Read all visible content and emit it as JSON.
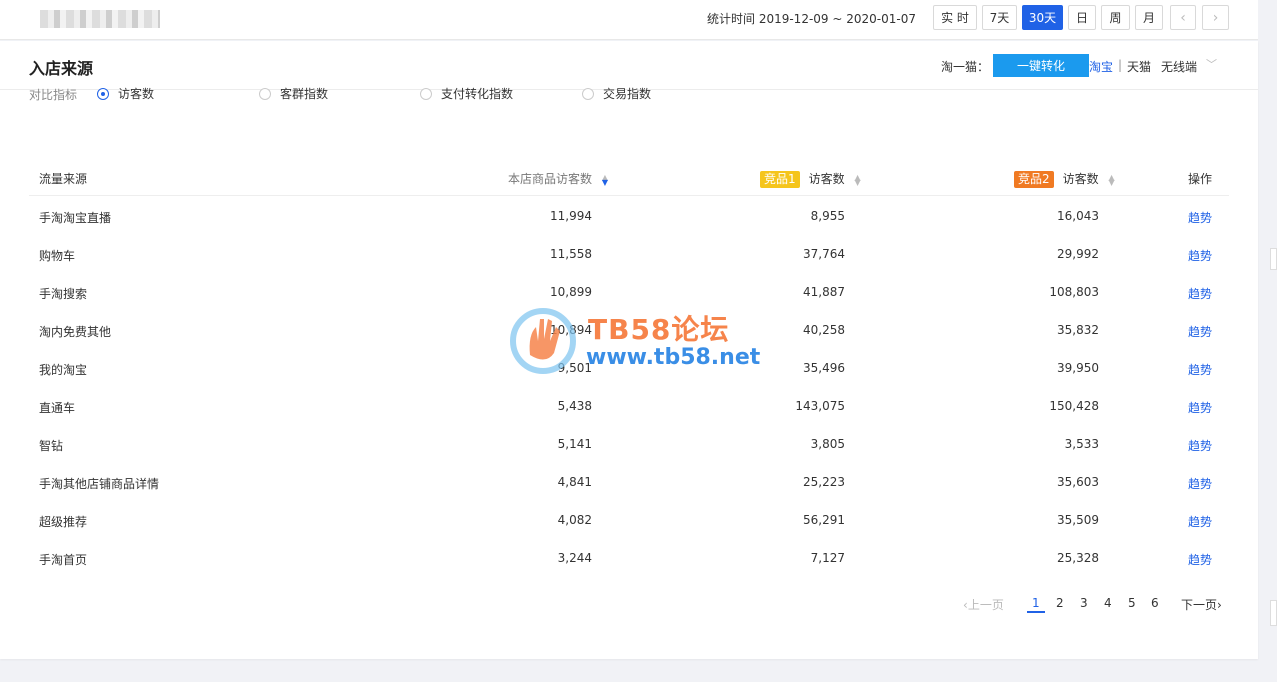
{
  "header": {
    "stat_time": "统计时间 2019-12-09 ~ 2020-01-07",
    "ranges": [
      "实 时",
      "7天",
      "30天",
      "日",
      "周",
      "月"
    ],
    "active_range": "30天",
    "prev_icon": "chevron-left-icon",
    "next_icon": "chevron-right-icon"
  },
  "panel": {
    "title": "入店来源",
    "taoyimao": "淘一猫：",
    "convert_btn": "一键转化",
    "platforms": {
      "taobao": "淘宝",
      "sep": "|",
      "tmall": "天猫",
      "wireless": "无线端"
    }
  },
  "compare": {
    "label": "对比指标",
    "options": [
      "访客数",
      "客群指数",
      "支付转化指数",
      "交易指数"
    ],
    "selected": "访客数"
  },
  "table": {
    "headers": {
      "source": "流量来源",
      "mine": "本店商品访客数",
      "p1_tag": "竞品1",
      "p1": "访客数",
      "p2_tag": "竞品2",
      "p2": "访客数",
      "op": "操作"
    },
    "rows": [
      {
        "source": "手淘淘宝直播",
        "mine": "11,994",
        "p1": "8,955",
        "p2": "16,043",
        "op": "趋势"
      },
      {
        "source": "购物车",
        "mine": "11,558",
        "p1": "37,764",
        "p2": "29,992",
        "op": "趋势"
      },
      {
        "source": "手淘搜索",
        "mine": "10,899",
        "p1": "41,887",
        "p2": "108,803",
        "op": "趋势"
      },
      {
        "source": "淘内免费其他",
        "mine": "10,894",
        "p1": "40,258",
        "p2": "35,832",
        "op": "趋势"
      },
      {
        "source": "我的淘宝",
        "mine": "9,501",
        "p1": "35,496",
        "p2": "39,950",
        "op": "趋势"
      },
      {
        "source": "直通车",
        "mine": "5,438",
        "p1": "143,075",
        "p2": "150,428",
        "op": "趋势"
      },
      {
        "source": "智钻",
        "mine": "5,141",
        "p1": "3,805",
        "p2": "3,533",
        "op": "趋势"
      },
      {
        "source": "手淘其他店铺商品详情",
        "mine": "4,841",
        "p1": "25,223",
        "p2": "35,603",
        "op": "趋势"
      },
      {
        "source": "超级推荐",
        "mine": "4,082",
        "p1": "56,291",
        "p2": "35,509",
        "op": "趋势"
      },
      {
        "source": "手淘首页",
        "mine": "3,244",
        "p1": "7,127",
        "p2": "25,328",
        "op": "趋势"
      }
    ]
  },
  "pagination": {
    "prev": "上一页",
    "pages": [
      "1",
      "2",
      "3",
      "4",
      "5",
      "6"
    ],
    "current": "1",
    "next": "下一页"
  },
  "watermark": {
    "line1": "TB58论坛",
    "line2": "www.tb58.net"
  },
  "colors": {
    "accent": "#2062e6",
    "convert": "#1b9aee",
    "tag1": "#f5c51c",
    "tag2": "#f07a23"
  }
}
